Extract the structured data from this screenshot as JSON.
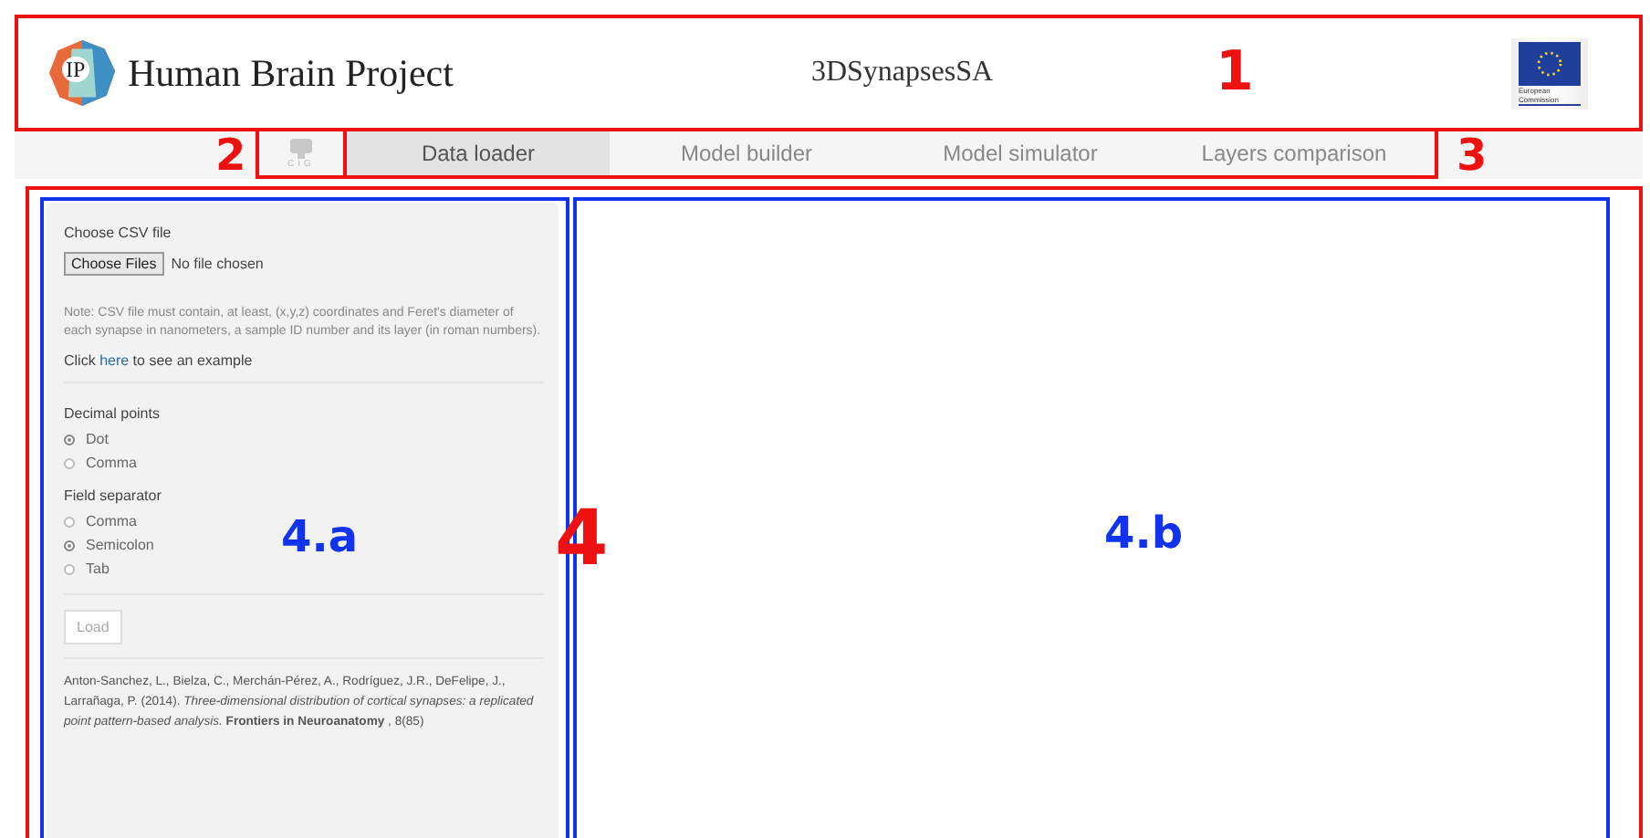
{
  "header": {
    "title": "Human Brain Project",
    "logo_text": "IP",
    "app_name": "3DSynapsesSA",
    "eu_logo_text": "European Commission",
    "annotation": {
      "label": "1",
      "color": "#ee1111"
    }
  },
  "nav": {
    "logo_text": "CIG",
    "left_annotation": {
      "label": "2",
      "color": "#ee1111"
    },
    "right_annotation": {
      "label": "3",
      "color": "#ee1111"
    },
    "tabs": [
      {
        "label": "Data loader",
        "selected": true
      },
      {
        "label": "Model builder",
        "selected": false
      },
      {
        "label": "Model simulator",
        "selected": false
      },
      {
        "label": "Layers comparison",
        "selected": false
      }
    ]
  },
  "main": {
    "annotation": {
      "label": "4",
      "color": "#ee1111"
    },
    "left_panel": {
      "annotation": {
        "label": "4.a",
        "color": "#1133ee"
      },
      "file_label": "Choose CSV file",
      "file_button": "Choose Files",
      "file_status": "No file chosen",
      "note": "Note: CSV file must contain, at least, (x,y,z) coordinates and Feret's diameter of each synapse in nanometers, a sample ID number and its layer (in roman numbers).",
      "example": {
        "before": "Click",
        "link": "here",
        "after": "to see an example"
      },
      "radio_groups": [
        {
          "label": "Decimal points",
          "options": [
            {
              "label": "Dot",
              "selected": true
            },
            {
              "label": "Comma",
              "selected": false
            }
          ]
        },
        {
          "label": "Field separator",
          "options": [
            {
              "label": "Comma",
              "selected": false
            },
            {
              "label": "Semicolon",
              "selected": true
            },
            {
              "label": "Tab",
              "selected": false
            }
          ]
        }
      ],
      "load_button": {
        "label": "Load",
        "disabled": true
      },
      "citation": "Anton-Sanchez, L., Bielza, C., Merchán-Pérez, A., Rodríguez, J.R., DeFelipe, J., Larrañaga, P. (2014). *Three-dimensional distribution of cortical synapses: a replicated point pattern-based analysis.* **Frontiers in Neuroanatomy** , 8(85)"
    },
    "right_panel": {
      "annotation": {
        "label": "4.b",
        "color": "#1133ee"
      }
    }
  }
}
